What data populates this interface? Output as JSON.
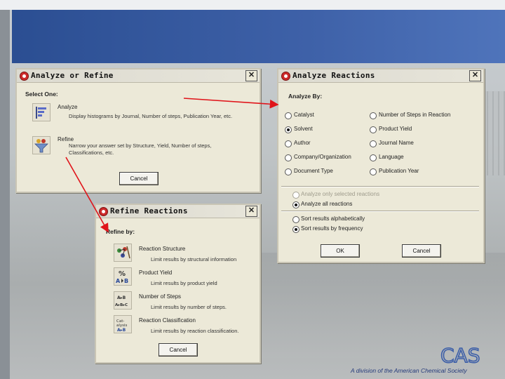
{
  "analyze_refine": {
    "title": "Analyze or Refine",
    "select_one": "Select One:",
    "analyze_label": "Analyze",
    "analyze_desc": "Display histograms by Journal, Number of steps, Publication Year, etc.",
    "refine_label": "Refine",
    "refine_desc_1": "Narrow your answer set by Structure, Yield, Number of steps,",
    "refine_desc_2": "Classifications, etc.",
    "cancel": "Cancel"
  },
  "analyze_reactions": {
    "title": "Analyze Reactions",
    "analyze_by": "Analyze By:",
    "left_options": [
      "Catalyst",
      "Solvent",
      "Author",
      "Company/Organization",
      "Document Type"
    ],
    "right_options": [
      "Number of Steps in Reaction",
      "Product Yield",
      "Journal Name",
      "Language",
      "Publication Year"
    ],
    "selected": "Solvent",
    "scope_options": [
      "Analyze only selected reactions",
      "Analyze all reactions"
    ],
    "sort_options": [
      "Sort results alphabetically",
      "Sort results by frequency"
    ],
    "ok": "OK",
    "cancel": "Cancel"
  },
  "refine_reactions": {
    "title": "Refine Reactions",
    "refine_by": "Refine by:",
    "items": [
      {
        "label": "Reaction Structure",
        "desc": "Limit results by structural information"
      },
      {
        "label": "Product Yield",
        "desc": "Limit results by product yield"
      },
      {
        "label": "Number of Steps",
        "desc": "Limit results by number of steps."
      },
      {
        "label": "Reaction Classification",
        "desc": "Limit results by reaction classification."
      }
    ],
    "cancel": "Cancel"
  },
  "footer": {
    "text": "A division of the American Chemical Society",
    "logo": "CAS"
  },
  "colors": {
    "banner": "#3e61a8",
    "arrow": "#e0141a",
    "dialog": "#ece9d8"
  }
}
